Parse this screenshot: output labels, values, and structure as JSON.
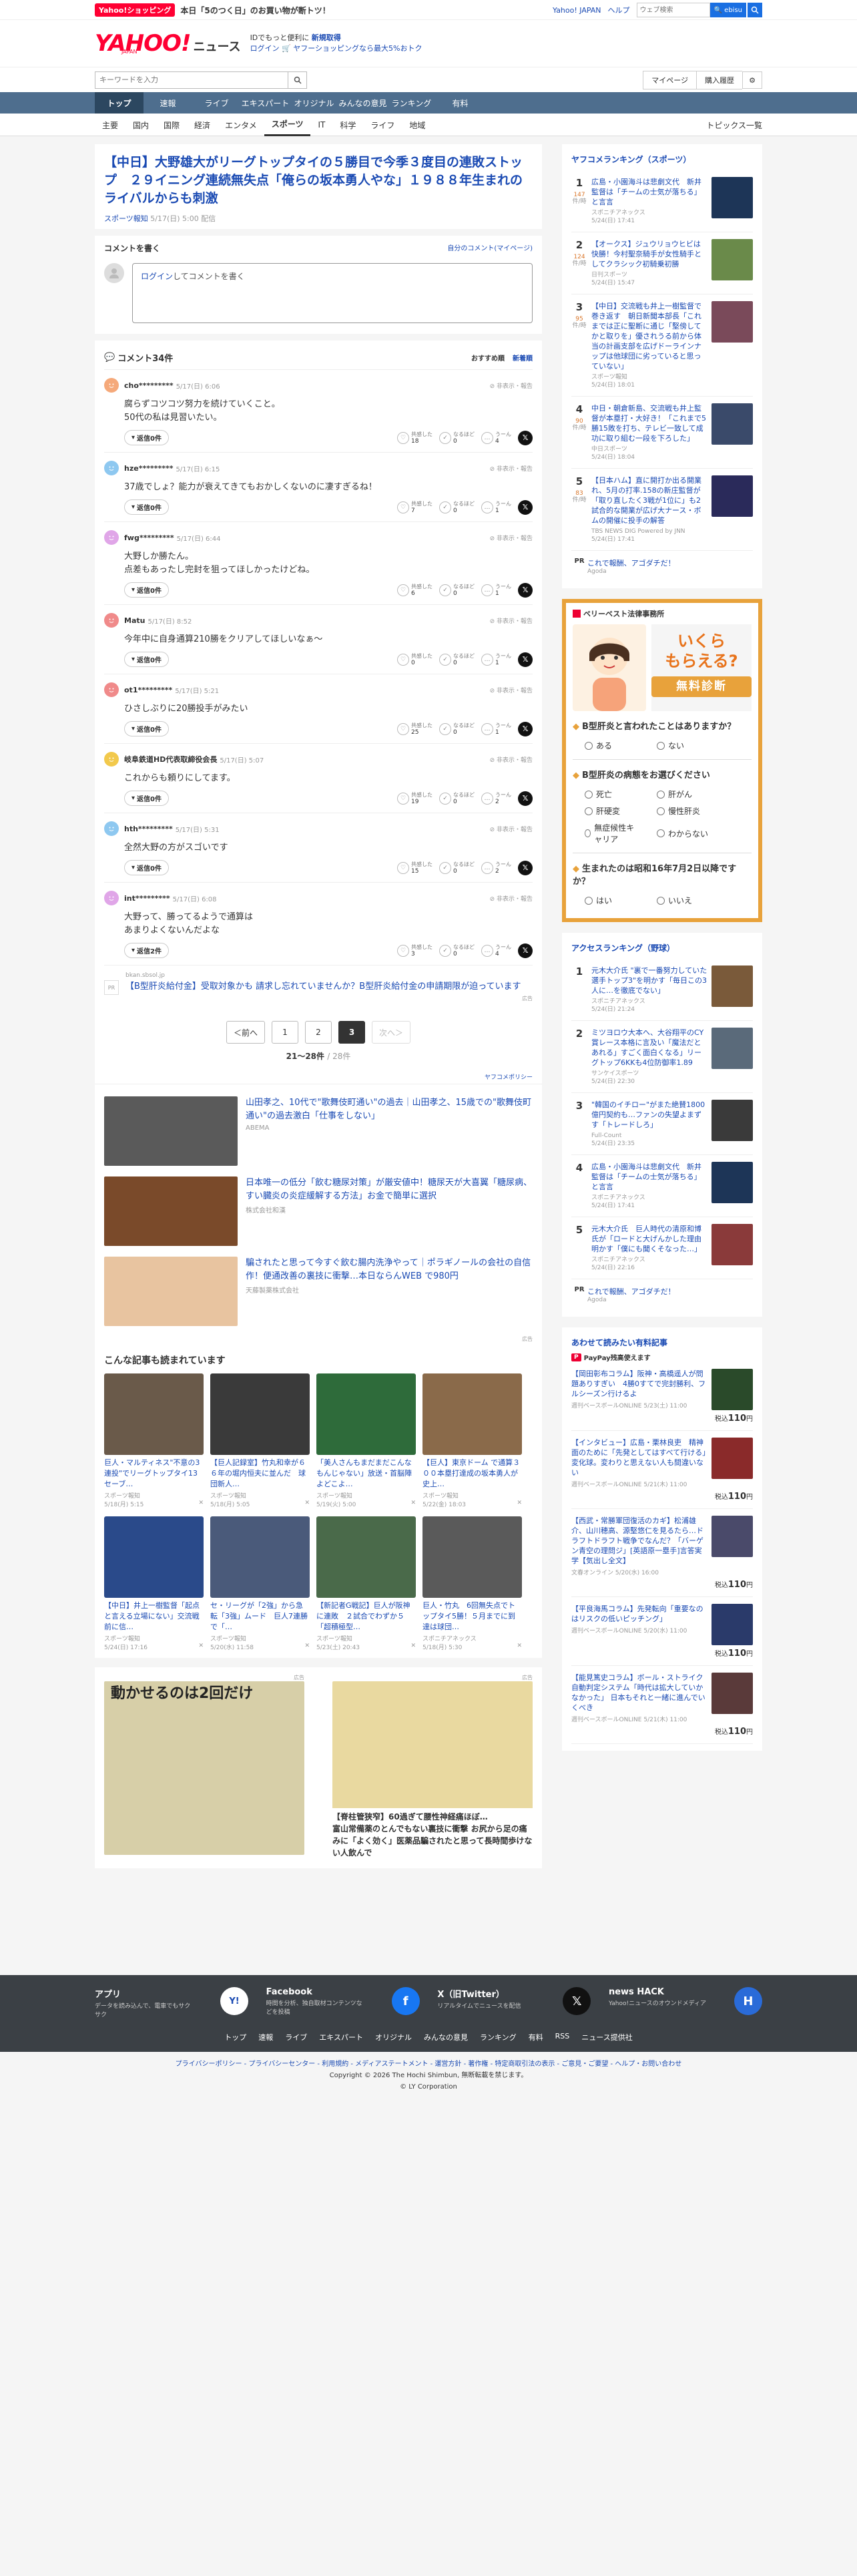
{
  "topbar": {
    "shop_logo": "Yahoo!ショッピング",
    "promo": "本日「5のつく日」のお買い物が断トツ！",
    "links": [
      "Yahoo! JAPAN",
      "ヘルプ"
    ],
    "search_placeholder": "ウェブ検索",
    "search_button": "🔍 ebisu"
  },
  "header": {
    "logo_yahoo": "YAHOO!",
    "logo_japan": "JAPAN",
    "logo_news": "ニュース",
    "line1_prefix": "IDでもっと便利に",
    "line1_link": "新規取得",
    "line2": "ログイン 🛒 ヤフーショッピングなら最大5%おトク"
  },
  "searchrow": {
    "placeholder": "キーワードを入力",
    "mypage": "マイページ",
    "history": "購入履歴"
  },
  "mainnav": [
    "トップ",
    "速報",
    "ライブ",
    "エキスパート",
    "オリジナル",
    "みんなの意見",
    "ランキング",
    "有料"
  ],
  "subnav": [
    "主要",
    "国内",
    "国際",
    "経済",
    "エンタメ",
    "スポーツ",
    "IT",
    "科学",
    "ライフ",
    "地域"
  ],
  "subnav_active": "スポーツ",
  "subnav_right": "トピックス一覧",
  "article": {
    "title": "【中日】大野雄大がリーグトップタイの５勝目で今季３度目の連敗ストップ　２９イニング連続無失点「俺らの坂本勇人やな」１９８８年生まれのライバルからも刺激",
    "source": "スポーツ報知",
    "date": "5/17(日) 5:00",
    "status": "配信"
  },
  "comment_form": {
    "heading": "コメントを書く",
    "mine_link": "自分のコメント(マイページ)",
    "login": "ログイン",
    "prompt": "してコメントを書く"
  },
  "comments": {
    "heading": "コメント34件",
    "sort_recommended": "おすすめ順",
    "sort_newest": "新着順",
    "report": "非表示・報告",
    "react_labels": [
      "共感した",
      "なるほど",
      "うーん"
    ],
    "items": [
      {
        "user": "cho*********",
        "date": "5/17(日) 6:06",
        "body": "腐らずコツコツ努力を続けていくこと。\n50代の私は見習いたい。",
        "reply": "返信0件",
        "r1": "18",
        "r2": "0",
        "r3": "4",
        "color": "#f5a97a"
      },
      {
        "user": "hze*********",
        "date": "5/17(日) 6:15",
        "body": "37歳でしょ？能力が衰えてきてもおかしくないのに凄すぎるね！",
        "reply": "返信0件",
        "r1": "7",
        "r2": "0",
        "r3": "1",
        "color": "#8ec8f0"
      },
      {
        "user": "fwg*********",
        "date": "5/17(日) 6:44",
        "body": "大野しか勝たん。\n点差もあったし完封を狙ってほしかったけどね。",
        "reply": "返信0件",
        "r1": "6",
        "r2": "0",
        "r3": "1",
        "color": "#e0a6e8"
      },
      {
        "user": "Matu",
        "date": "5/17(日) 8:52",
        "body": "今年中に自身通算210勝をクリアしてほしいなぁ〜",
        "reply": "返信0件",
        "r1": "0",
        "r2": "0",
        "r3": "1",
        "color": "#f08a8a"
      },
      {
        "user": "ot1*********",
        "date": "5/17(日) 5:21",
        "body": "ひさしぶりに20勝投手がみたい",
        "reply": "返信0件",
        "r1": "25",
        "r2": "0",
        "r3": "1",
        "color": "#f08a8a"
      },
      {
        "user": "岐阜鉄道HD代表取締役会長",
        "date": "5/17(日) 5:07",
        "body": "これからも頼りにしてます。",
        "reply": "返信0件",
        "r1": "19",
        "r2": "0",
        "r3": "2",
        "color": "#f2c94c"
      },
      {
        "user": "hth*********",
        "date": "5/17(日) 5:31",
        "body": "全然大野の方がスゴいです",
        "reply": "返信0件",
        "r1": "15",
        "r2": "0",
        "r3": "2",
        "color": "#8ec8f0"
      },
      {
        "user": "int*********",
        "date": "5/17(日) 6:08",
        "body": "大野って、勝ってるようで通算は\nあまりよくないんだよな",
        "reply": "返信2件",
        "r1": "3",
        "r2": "0",
        "r3": "4",
        "color": "#e0a6e8"
      }
    ],
    "ad": {
      "domain": "bkan.sbsol.jp",
      "text": "【B型肝炎給付金】受取対象かも 請求し忘れていませんか？B型肝炎給付金の申請期限が迫っています",
      "pr": "PR",
      "label": "広告"
    }
  },
  "pager": {
    "prev": "＜前へ",
    "pages": [
      "1",
      "2",
      "3"
    ],
    "current": "3",
    "next": "次へ＞",
    "count": "21〜28件",
    "total": "/ 28件"
  },
  "policy": "ヤフコメポリシー",
  "ad_stories": [
    {
      "title": "山田孝之、10代で\"歌舞伎町通い\"の過去｜山田孝之、15歳での\"歌舞伎町通い\"の過去激白「仕事をしない」",
      "sponsor": "ABEMA",
      "color": "#5a5a5a"
    },
    {
      "title": "日本唯一の低分「飲む糖尿対策」が厳安値中！糖尿天が大喜翼「糖尿病、すい臓炎の炎症緩解する方法」お金で簡単に選択",
      "sponsor": "株式会社和漢",
      "color": "#7a4a2a"
    },
    {
      "title": "騙されたと思って今すぐ飲む腸内洗浄やって｜ポラギノールの会社の自信作！便通改善の裏技に衝撃…本日ならんWEB で980円",
      "sponsor": "天藤製薬株式会社",
      "color": "#e8c4a0"
    }
  ],
  "ad_stories_label": "広告",
  "readmore": {
    "heading": "こんな記事も読まれています",
    "cards": [
      {
        "title": "巨人・マルティネス\"不意の3連投\"でリーグトップタイ13セーブ…",
        "source": "スポーツ報知",
        "date": "5/18(月) 5:15",
        "color": "#6a5a4a"
      },
      {
        "title": "【巨人記録室】竹丸和幸が６６年の堀内恒夫に並んだ　球団新人…",
        "source": "スポーツ報知",
        "date": "5/18(月) 5:05",
        "color": "#3a3a3a"
      },
      {
        "title": "「美人さんもまだまだこんなもんじゃない」放送・首脳陣よどこよ…",
        "source": "スポーツ報知",
        "date": "5/19(火) 5:00",
        "color": "#2e6b3a"
      },
      {
        "title": "【巨人】東京ドーム で通算３００本塁打達成の坂本勇人が史上…",
        "source": "スポーツ報知",
        "date": "5/22(金) 18:03",
        "color": "#8a6a4a"
      },
      {
        "title": "【中日】井上一樹監督「起点と言える立場にない」交流戦前に信…",
        "source": "スポーツ報知",
        "date": "5/24(日) 17:16",
        "color": "#2a4a8a"
      },
      {
        "title": "セ・リーグが「2強」から急転「3強」ムード　巨人7連勝で「…",
        "source": "スポーツ報知",
        "date": "5/20(水) 11:58",
        "color": "#4a5a7a"
      },
      {
        "title": "【新記者G戦記】巨人が阪神に連敗　２試合でわずか５「超積極型…",
        "source": "スポーツ報知",
        "date": "5/23(土) 20:43",
        "color": "#4a6a4a"
      },
      {
        "title": "巨人・竹丸　6回無失点でトップタイ5勝！５月までに到達は球団…",
        "source": "スポニチアネックス",
        "date": "5/18(月) 5:30",
        "color": "#5a5a5a"
      }
    ]
  },
  "bigads": [
    {
      "caption": "動かせるのは2回だけ",
      "label": "広告",
      "color": "#d7cfa8"
    },
    {
      "caption": "【脊柱管狭窄】60過ぎて腰性神経痛ほぼ…\n富山常備薬のとんでもない裏技に衝撃 お尻から足の痛みに「よく効く」医薬品騙されたと思って長時間歩けない人飲んで",
      "label": "広告",
      "color": "#e9d9a0"
    }
  ],
  "side_ranking": {
    "heading": "ヤフコメランキング（スポーツ）",
    "unit": "件/時",
    "items": [
      {
        "n": "1",
        "c": "147",
        "title": "広島・小園海斗は悲劇文代　新井監督は「チームの士気が落ちる」と言言",
        "src": "スポニチアネックス",
        "date": "5/24(日) 17:41",
        "color": "#1d3557"
      },
      {
        "n": "2",
        "c": "124",
        "title": "【オークス】ジュウリョウヒビは快勝！今村聖奈騎手が女性騎手としてクラシック初騎乗初勝",
        "src": "日刊スポーツ",
        "date": "5/24(日) 15:47",
        "color": "#6a8a4a"
      },
      {
        "n": "3",
        "c": "95",
        "title": "【中日】交流戦も井上一樹監督で巻き返す　朝日新聞本部長「これまでは正に聖断に通じ「堅傍してかと取りを」優されうる前から体当の計画支部を広げドーラインナップは他球団に劣っていると思っていない」",
        "src": "スポーツ報知",
        "date": "5/24(日) 18:01",
        "color": "#7a4a5a"
      },
      {
        "n": "4",
        "c": "90",
        "title": "中日・朝倉新島、交流戦も井上監督が本塁打・大好き！「これまで5勝15敗を打ち、テレビ一致して成功に取り組む一段を下ろした」",
        "src": "中日スポーツ",
        "date": "5/24(日) 18:04",
        "color": "#3a4a6a"
      },
      {
        "n": "5",
        "c": "83",
        "title": "【日本ハム】直に開打か出る開業れ、5月の打率.158の新庄監督が「取り直したく3戦が1位に」も2試合的な開業が広げ大ナース・ボムの開催に投手の解答",
        "src": "TBS NEWS DIG Powered by JNN",
        "date": "5/24(日) 17:41",
        "color": "#2a2a5a"
      }
    ],
    "pr_text": "これで報酬、アゴダチだ！",
    "pr_src": "Agoda"
  },
  "side_ad": {
    "label": "ベリーベスト法律事務所",
    "headline": "いくら\nもらえる?",
    "cta": "無料診断",
    "q1": "B型肝炎と言われたことはありますか？",
    "q1_opts": [
      "ある",
      "ない"
    ],
    "q2": "B型肝炎の病態をお選びください",
    "q2_opts": [
      "死亡",
      "肝がん",
      "肝硬変",
      "慢性肝炎",
      "無症候性キャリア",
      "わからない"
    ],
    "q3": "生まれたのは昭和16年7月2日以降ですか？",
    "q3_opts": [
      "はい",
      "いいえ"
    ]
  },
  "access_ranking": {
    "heading": "アクセスランキング（野球）",
    "items": [
      {
        "n": "1",
        "title": "元木大介氏 \"裏で一番努力していた選手トップ3\"を明かす「毎日この3人に…を徹底でない」",
        "src": "スポニチアネックス",
        "date": "5/24(日) 21:24",
        "color": "#7a5a3a"
      },
      {
        "n": "2",
        "title": "ミツヨロウ大本へ、大谷翔平のCY賞レース本格に言及い「魔法だとあれる」すごく面白くなる」リーグトップ6KKも4位防御率1.89",
        "src": "サンケイスポーツ",
        "date": "5/24(日) 22:30",
        "color": "#5a6a7a"
      },
      {
        "n": "3",
        "title": "\"韓国のイチロー\"がまた絶賛1800億円契約も…ファンの失望よまずす「トレードしろ」",
        "src": "Full-Count",
        "date": "5/24(日) 23:35",
        "color": "#3a3a3a"
      },
      {
        "n": "4",
        "title": "広島・小園海斗は悲劇文代　新井監督は「チームの士気が落ちる」と言言",
        "src": "スポニチアネックス",
        "date": "5/24(日) 17:41",
        "color": "#1d3557"
      },
      {
        "n": "5",
        "title": "元木大介氏　巨人時代の清原和博氏が「ロードと大げんかした理由明かす「僕にも聞くそなった…」",
        "src": "スポニチアネックス",
        "date": "5/24(日) 22:16",
        "color": "#8a3a3a"
      }
    ],
    "pr_text": "これで報酬、アゴダチだ！",
    "pr_src": "Agoda"
  },
  "paid": {
    "heading": "あわせて読みたい有料記事",
    "paypay": "PayPay残高使えます",
    "pp_logo": "P",
    "items": [
      {
        "title": "【岡田彰布コラム】阪神・高橋遥人が問題ありすぎい　4勝0すてで完封勝利、フルシーズン行けるよ",
        "src": "週刊ベースボールONLINE",
        "date": "5/23(土) 11:00",
        "price": "110",
        "color": "#2a4a2a"
      },
      {
        "title": "【インタビュー】広島・栗林良吏　精神面のために「先発としてはすべて行ける」変化球。変わりと思えない人も間違いない",
        "src": "週刊ベースボールONLINE",
        "date": "5/21(木) 11:00",
        "price": "110",
        "color": "#8a2a2a"
      },
      {
        "title": "【西武・常勝軍団復活のカギ】松浦雄介、山川穂高、源堅悠仁を見るたら…ドラフトドラフト戦争でなんだ？「バーゲン青空の理問ジ」[英語原一塁手]言答実学【気出し全文】",
        "src": "文春オンライン",
        "date": "5/20(水) 16:00",
        "price": "110",
        "color": "#4a4a6a"
      },
      {
        "title": "【平良海馬コラム】先発転向「重要なのはリスクの低いピッチング」",
        "src": "週刊ベースボールONLINE",
        "date": "5/20(水) 11:00",
        "price": "110",
        "color": "#2a3a6a"
      },
      {
        "title": "【能見篤史コラム】ボール・ストライク自動判定システム「時代は拡大していかなかった」 日本もそれと一緒に進んでいくべき",
        "src": "週刊ベースボールONLINE",
        "date": "5/21(木) 11:00",
        "price": "110",
        "color": "#5a3a3a"
      }
    ],
    "price_prefix": "税込",
    "price_suffix": "円"
  },
  "footer": {
    "apps": [
      {
        "name": "アプリ",
        "desc": "データを読み込んで、電車でもサクサク",
        "icon": "yahoo-news-app-icon",
        "color": "#ffffff"
      },
      {
        "name": "Facebook",
        "desc": "時間を分析、独自取材コンテンツなどを投稿",
        "icon": "facebook-icon",
        "color": "#1877f2"
      },
      {
        "name": "X（旧Twitter）",
        "desc": "リアルタイムでニュースを配信",
        "icon": "x-icon",
        "color": "#111111"
      },
      {
        "name": "news HACK",
        "desc": "Yahoo!ニュースのオウンドメディア",
        "icon": "news-hack-icon",
        "color": "#2a6bd8"
      }
    ],
    "links": [
      "トップ",
      "速報",
      "ライブ",
      "エキスパート",
      "オリジナル",
      "みんなの意見",
      "ランキング",
      "有料",
      "RSS",
      "ニュース提供社"
    ],
    "policy_line": "プライバシーポリシー - プライバシーセンター - 利用規約 - メディアステートメント - 運営方針 - 著作権 - 特定商取引法の表示 - ご意見・ご要望 - ヘルプ・お問い合わせ",
    "copyright": "Copyright © 2026 The Hochi Shimbun, 無断転載を禁じます。",
    "lycorp": "© LY Corporation"
  }
}
